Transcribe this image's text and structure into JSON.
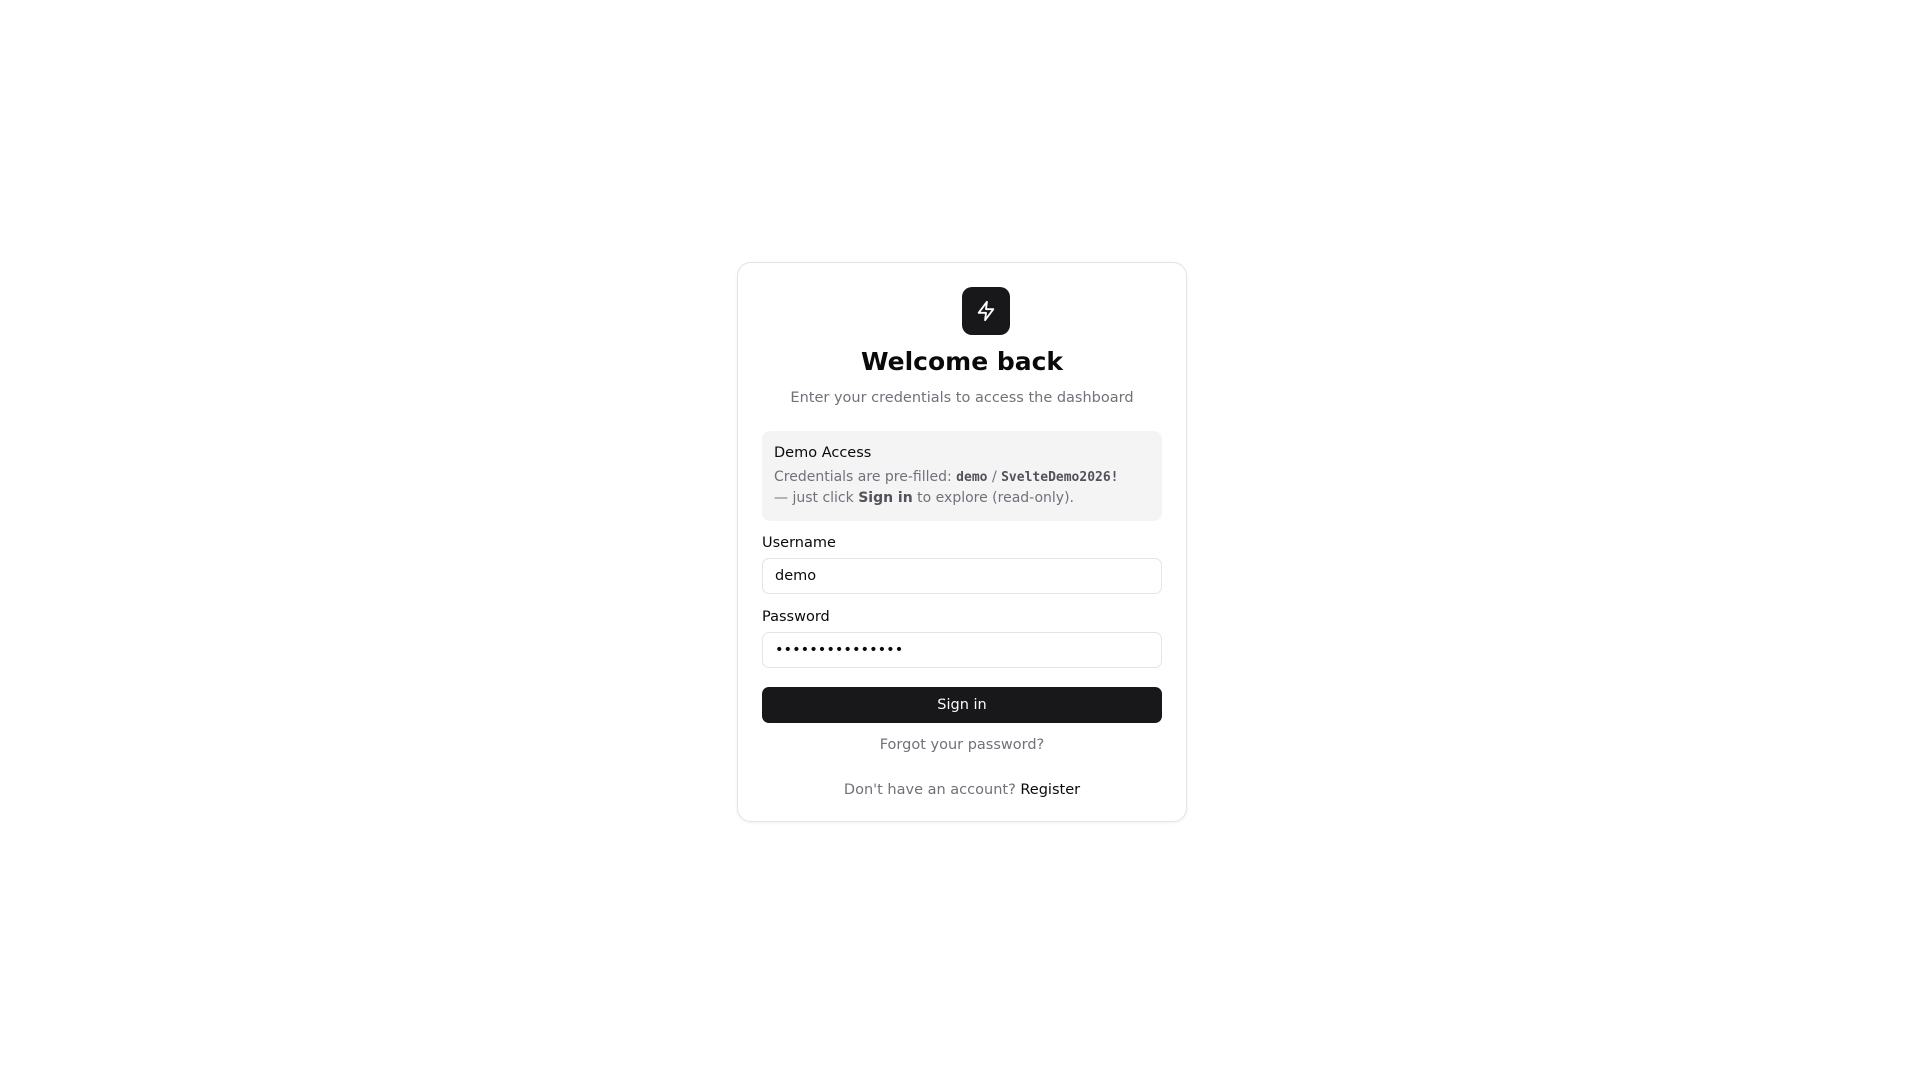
{
  "logo": {
    "icon": "lightning-bolt-icon",
    "background": "#18181b"
  },
  "header": {
    "title": "Welcome back",
    "subtitle": "Enter your credentials to access the dashboard"
  },
  "demo_notice": {
    "title": "Demo Access",
    "text_prefix": "Credentials are pre-filled:",
    "username": "demo",
    "separator": "/",
    "password": "SvelteDemo2026!",
    "text_middle": "— just click",
    "action": "Sign in",
    "text_suffix": "to explore (read-only)."
  },
  "form": {
    "username_label": "Username",
    "username_value": "demo",
    "password_label": "Password",
    "password_value": "SvelteDemo2026!",
    "submit_label": "Sign in"
  },
  "links": {
    "forgot_password": "Forgot your password?",
    "no_account": "Don't have an account?",
    "register": "Register"
  },
  "colors": {
    "primary": "#18181b",
    "muted_text": "#71717a",
    "demo_box_bg": "#f4f4f5"
  }
}
